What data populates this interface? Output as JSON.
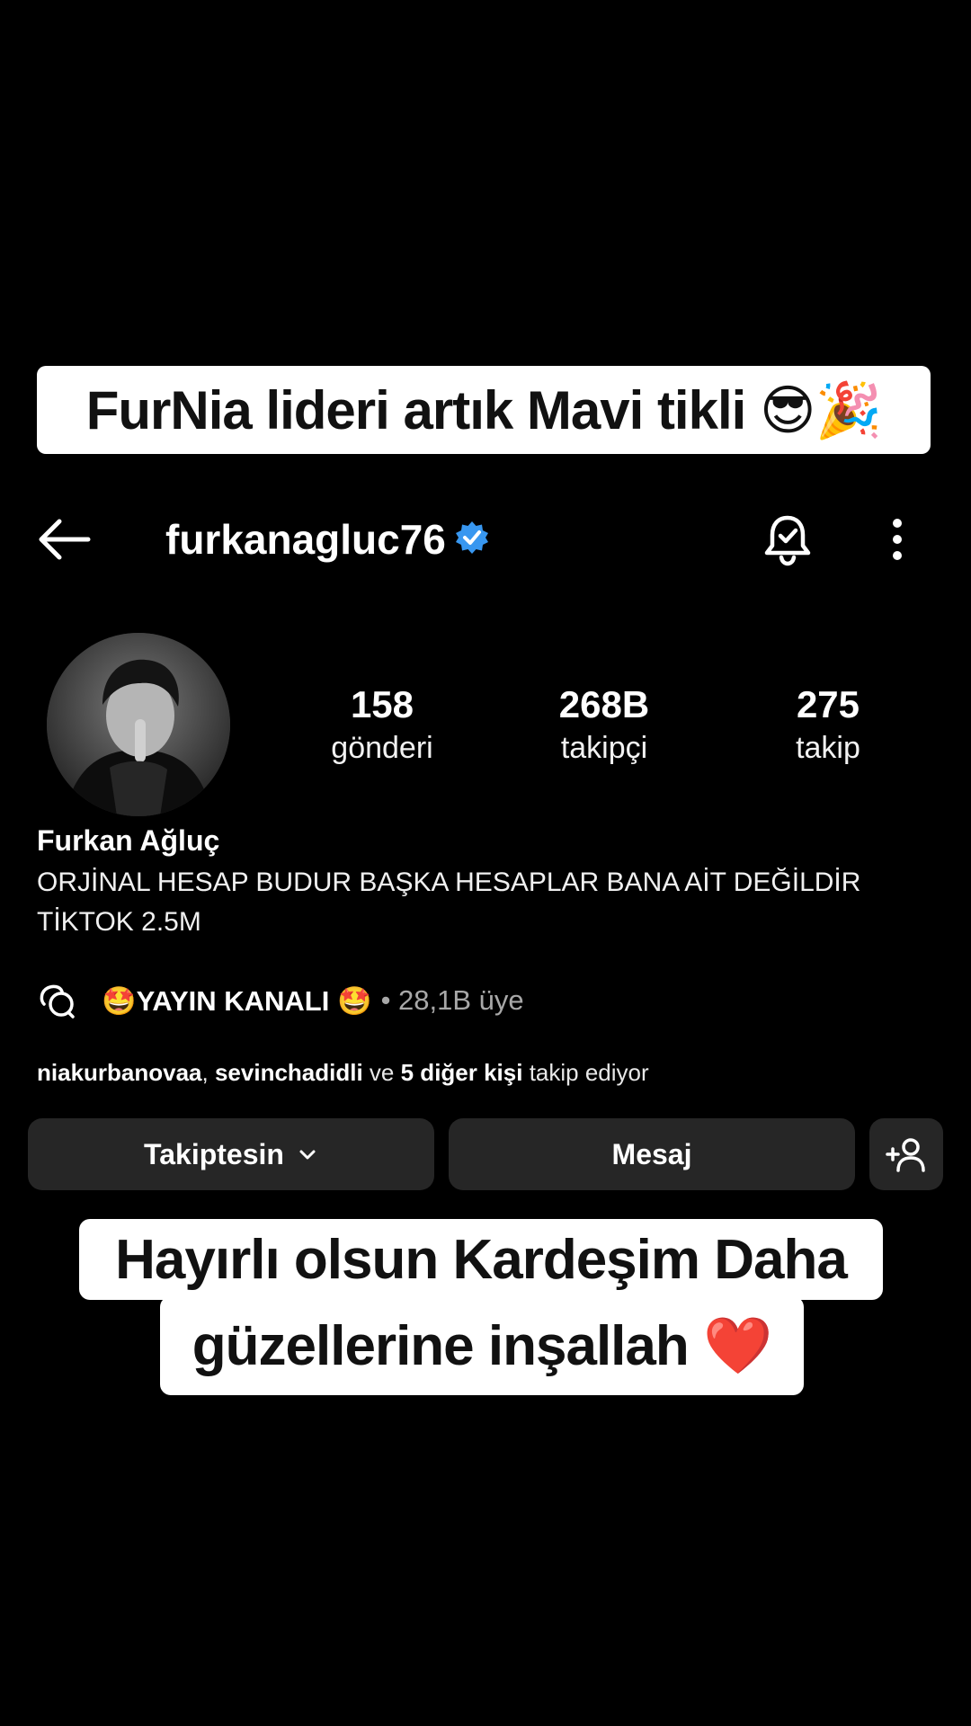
{
  "caption_top": "FurNia lideri artık Mavi tikli 😎🎉",
  "header": {
    "username": "furkanagluc76"
  },
  "stats": [
    {
      "value": "158",
      "label": "gönderi"
    },
    {
      "value": "268B",
      "label": "takipçi"
    },
    {
      "value": "275",
      "label": "takip"
    }
  ],
  "profile": {
    "full_name": "Furkan Ağluç",
    "bio_line1": "ORJİNAL HESAP BUDUR BAŞKA HESAPLAR BANA AİT DEĞİLDİR",
    "bio_line2": "TİKTOK 2.5M"
  },
  "channel": {
    "name": "🤩YAYIN KANALI 🤩",
    "meta": "• 28,1B üye"
  },
  "followed_by": {
    "user1": "niakurbanovaa",
    "sep": ", ",
    "user2": "sevinchadidli",
    "ve": " ve ",
    "others": "5 diğer kişi",
    "suffix": " takip ediyor"
  },
  "buttons": {
    "following": "Takiptesin",
    "message": "Mesaj"
  },
  "caption_bottom": {
    "line1": "Hayırlı olsun Kardeşim Daha",
    "line2": "güzellerine inşallah ❤️"
  },
  "colors": {
    "verified": "#3897f0",
    "button_bg": "#262626"
  },
  "icons": [
    "back-arrow-icon",
    "verified-badge-icon",
    "bell-icon",
    "more-vertical-icon",
    "channel-chat-icon",
    "chevron-down-icon",
    "add-person-icon"
  ]
}
